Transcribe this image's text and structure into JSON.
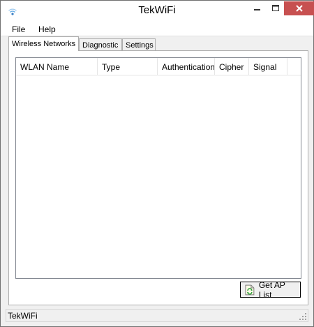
{
  "window": {
    "title": "TekWiFi",
    "app_icon": "wifi-signal-icon",
    "controls": {
      "minimize_icon": "minimize-icon",
      "maximize_icon": "maximize-icon",
      "close_icon": "close-icon",
      "close_color": "#c75050"
    }
  },
  "menu": {
    "items": [
      {
        "label": "File"
      },
      {
        "label": "Help"
      }
    ]
  },
  "tabs": [
    {
      "label": "Wireless Networks",
      "selected": true
    },
    {
      "label": "Diagnostic",
      "selected": false
    },
    {
      "label": "Settings",
      "selected": false
    }
  ],
  "list": {
    "columns": [
      "WLAN Name",
      "Type",
      "Authentication",
      "Cipher",
      "Signal"
    ],
    "rows": []
  },
  "buttons": {
    "get_ap_list": {
      "label": "Get AP List",
      "icon": "refresh-document-icon"
    }
  },
  "status": {
    "text": "TekWiFi"
  }
}
